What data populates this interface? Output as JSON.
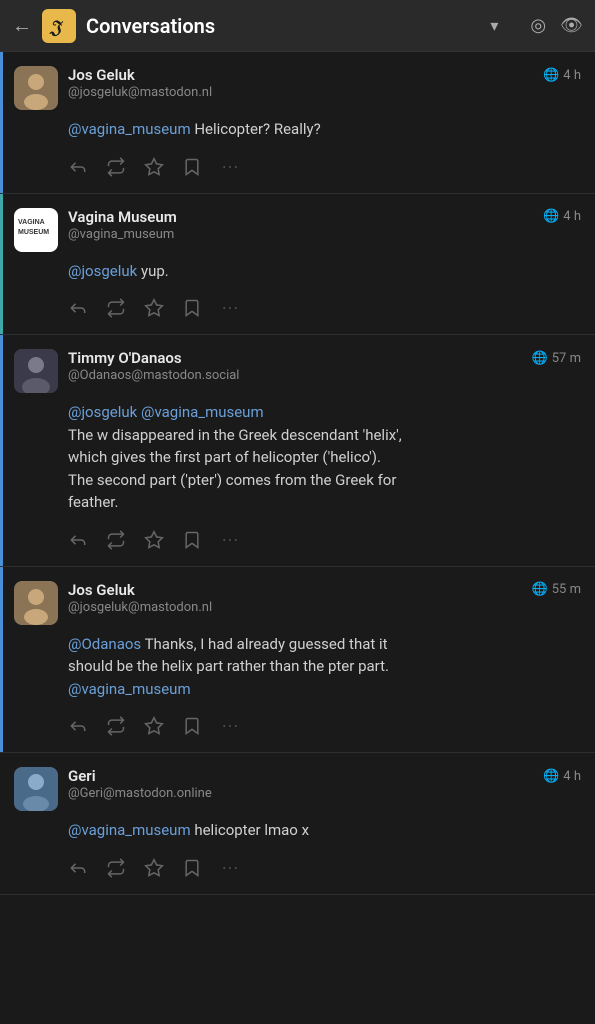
{
  "topbar": {
    "back_label": "←",
    "logo_text": "𝔍",
    "title": "Conversations",
    "chevron": "▾"
  },
  "conversations": [
    {
      "id": "conv1",
      "accent": "blue",
      "user": {
        "name": "Jos Geluk",
        "handle": "@josgeluk@mastodon.nl",
        "avatar_type": "jos"
      },
      "time": "4 h",
      "body_parts": [
        {
          "type": "mention",
          "text": "@vagina_museum"
        },
        {
          "type": "text",
          "text": " Helicopter? Really?"
        }
      ]
    },
    {
      "id": "conv2",
      "accent": "teal",
      "user": {
        "name": "Vagina Museum",
        "handle": "@vagina_museum",
        "avatar_type": "vagina"
      },
      "time": "4 h",
      "body_parts": [
        {
          "type": "mention",
          "text": "@josgeluk"
        },
        {
          "type": "text",
          "text": " yup."
        }
      ]
    },
    {
      "id": "conv3",
      "accent": "blue",
      "user": {
        "name": "Timmy O'Danaos",
        "handle": "@Odanaos@mastodon.social",
        "avatar_type": "timmy"
      },
      "time": "57 m",
      "body_parts": [
        {
          "type": "mention",
          "text": "@josgeluk"
        },
        {
          "type": "text",
          "text": " "
        },
        {
          "type": "mention",
          "text": "@vagina_museum"
        },
        {
          "type": "text",
          "text": "\nThe w disappeared in the Greek descendant 'helix',\nwhich gives the first part of helicopter ('helico').\nThe second part ('pter') comes from the Greek for\nfeather."
        }
      ]
    },
    {
      "id": "conv4",
      "accent": "blue",
      "user": {
        "name": "Jos Geluk",
        "handle": "@josgeluk@mastodon.nl",
        "avatar_type": "jos"
      },
      "time": "55 m",
      "body_parts": [
        {
          "type": "mention",
          "text": "@Odanaos"
        },
        {
          "type": "text",
          "text": " Thanks, I had already guessed that it\nshould be the helix part rather than the pter part.\n"
        },
        {
          "type": "mention",
          "text": "@vagina_museum"
        }
      ]
    },
    {
      "id": "conv5",
      "accent": "none",
      "user": {
        "name": "Geri",
        "handle": "@Geri@mastodon.online",
        "avatar_type": "geri"
      },
      "time": "4 h",
      "body_parts": [
        {
          "type": "mention",
          "text": "@vagina_museum"
        },
        {
          "type": "text",
          "text": " helicopter lmao x"
        }
      ]
    }
  ]
}
